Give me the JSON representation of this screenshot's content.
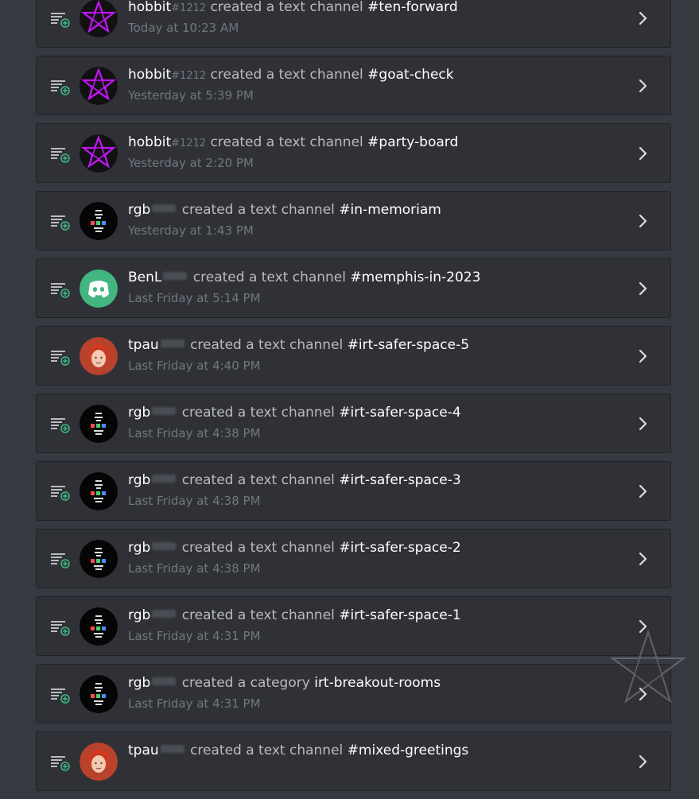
{
  "entries": [
    {
      "avatar": "pentagram-avatar",
      "user": "hobbit",
      "discriminator": "#1212",
      "redacted": false,
      "action": "created a text channel",
      "target": "#ten-forward",
      "time": "Today at 10:23 AM"
    },
    {
      "avatar": "pentagram-avatar",
      "user": "hobbit",
      "discriminator": "#1212",
      "redacted": false,
      "action": "created a text channel",
      "target": "#goat-check",
      "time": "Yesterday at 5:39 PM"
    },
    {
      "avatar": "pentagram-avatar",
      "user": "hobbit",
      "discriminator": "#1212",
      "redacted": false,
      "action": "created a text channel",
      "target": "#party-board",
      "time": "Yesterday at 2:20 PM"
    },
    {
      "avatar": "rgb-avatar",
      "user": "rgb",
      "discriminator": "",
      "redacted": true,
      "action": "created a text channel",
      "target": "#in-memoriam",
      "time": "Yesterday at 1:43 PM"
    },
    {
      "avatar": "discord-avatar",
      "user": "BenL",
      "discriminator": "",
      "redacted": true,
      "action": "created a text channel",
      "target": "#memphis-in-2023",
      "time": "Last Friday at 5:14 PM"
    },
    {
      "avatar": "photo-avatar",
      "user": "tpau",
      "discriminator": "",
      "redacted": true,
      "action": "created a text channel",
      "target": "#irt-safer-space-5",
      "time": "Last Friday at 4:40 PM"
    },
    {
      "avatar": "rgb-avatar",
      "user": "rgb",
      "discriminator": "",
      "redacted": true,
      "action": "created a text channel",
      "target": "#irt-safer-space-4",
      "time": "Last Friday at 4:38 PM"
    },
    {
      "avatar": "rgb-avatar",
      "user": "rgb",
      "discriminator": "",
      "redacted": true,
      "action": "created a text channel",
      "target": "#irt-safer-space-3",
      "time": "Last Friday at 4:38 PM"
    },
    {
      "avatar": "rgb-avatar",
      "user": "rgb",
      "discriminator": "",
      "redacted": true,
      "action": "created a text channel",
      "target": "#irt-safer-space-2",
      "time": "Last Friday at 4:38 PM"
    },
    {
      "avatar": "rgb-avatar",
      "user": "rgb",
      "discriminator": "",
      "redacted": true,
      "action": "created a text channel",
      "target": "#irt-safer-space-1",
      "time": "Last Friday at 4:31 PM"
    },
    {
      "avatar": "rgb-avatar",
      "user": "rgb",
      "discriminator": "",
      "redacted": true,
      "action": "created a category",
      "target": "irt-breakout-rooms",
      "time": "Last Friday at 4:31 PM"
    },
    {
      "avatar": "photo-avatar",
      "user": "tpau",
      "discriminator": "",
      "redacted": true,
      "action": "created a text channel",
      "target": "#mixed-greetings",
      "time": ""
    }
  ],
  "icons": {
    "action": "channel-create-icon",
    "expand": "chevron-right-icon",
    "watermark": "pentagram-watermark-icon"
  },
  "colors": {
    "background": "#36393f",
    "card": "#2f3136",
    "card_border": "#202225",
    "create_green": "#43b581",
    "pentagram_purple": "#b200e8",
    "discord_green": "#43b581",
    "muted_text": "#72767d"
  }
}
